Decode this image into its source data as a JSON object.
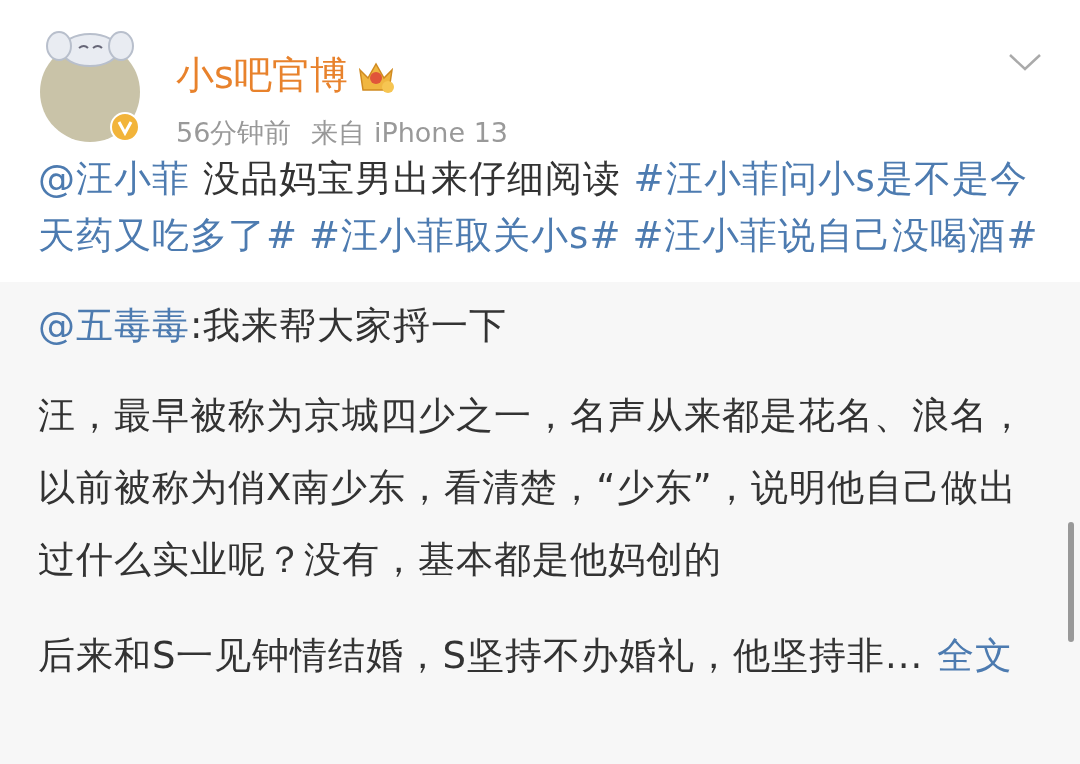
{
  "post": {
    "author": "小s吧官博",
    "time": "56分钟前",
    "source": "来自 iPhone 13",
    "segments": [
      {
        "kind": "mention",
        "text": "@汪小菲"
      },
      {
        "kind": "text",
        "text": " 没品妈宝男出来仔细阅读 "
      },
      {
        "kind": "hashtag",
        "text": "#汪小菲问小s是不是今天药又吃多了#"
      },
      {
        "kind": "hashtag",
        "text": "#汪小菲取关小s#"
      },
      {
        "kind": "hashtag",
        "text": "#汪小菲说自己没喝酒#"
      }
    ]
  },
  "repost": {
    "segments": [
      {
        "kind": "mention",
        "text": "@五毒毒"
      },
      {
        "kind": "text",
        "text": ":我来帮大家捋一下"
      }
    ],
    "paragraphs": [
      "汪，最早被称为京城四少之一，名声从来都是花名、浪名，以前被称为俏X南少东，看清楚，“少东”，说明他自己做出过什么实业呢？没有，基本都是他妈创的",
      "后来和S一见钟情结婚，S坚持不办婚礼，他坚持非..."
    ],
    "more": "全文"
  }
}
